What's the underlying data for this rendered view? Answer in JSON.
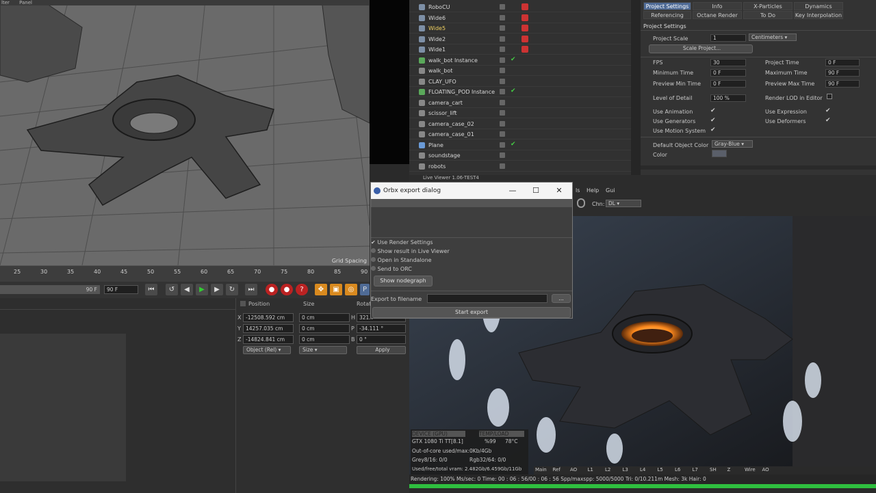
{
  "viewport": {
    "menu": [
      "lter",
      "Panel"
    ],
    "grid_label": "Grid Spacing"
  },
  "timeline": {
    "ticks": [
      "25",
      "30",
      "35",
      "40",
      "45",
      "50",
      "55",
      "60",
      "65",
      "70",
      "75",
      "80",
      "85",
      "90"
    ],
    "frame_field": "90 F",
    "slider_value": "90 F"
  },
  "coordinates": {
    "headers": {
      "position": "Position",
      "size": "Size",
      "rotation": "Rotat"
    },
    "rows": [
      {
        "axis": "X",
        "pos": "-12508.592 cm",
        "size": "0 cm",
        "rot_axis": "H",
        "rot": "321.7"
      },
      {
        "axis": "Y",
        "pos": "14257.035 cm",
        "size": "0 cm",
        "rot_axis": "P",
        "rot": "-34.111 °"
      },
      {
        "axis": "Z",
        "pos": "-14824.841 cm",
        "size": "0 cm",
        "rot_axis": "B",
        "rot": "0 °"
      }
    ],
    "mode": "Object (Rel)",
    "size_mode": "Size",
    "apply": "Apply"
  },
  "objects": [
    {
      "name": "RoboCU",
      "icon": "camera-icon",
      "tag": true
    },
    {
      "name": "Wide6",
      "icon": "camera-icon",
      "tag": true
    },
    {
      "name": "Wide5",
      "icon": "camera-icon",
      "tag": true,
      "highlight": true
    },
    {
      "name": "Wide2",
      "icon": "camera-icon",
      "tag": true
    },
    {
      "name": "Wide1",
      "icon": "camera-icon",
      "tag": true
    },
    {
      "name": "walk_bot Instance",
      "icon": "instance-icon",
      "check": true
    },
    {
      "name": "walk_bot",
      "icon": "null-icon"
    },
    {
      "name": "CLAY_UFO",
      "icon": "null-icon"
    },
    {
      "name": "FLOATING_POD Instance",
      "icon": "instance-icon",
      "check": true
    },
    {
      "name": "camera_cart",
      "icon": "null-icon"
    },
    {
      "name": "scissor_lift",
      "icon": "null-icon"
    },
    {
      "name": "camera_case_02",
      "icon": "null-icon"
    },
    {
      "name": "camera_case_01",
      "icon": "null-icon"
    },
    {
      "name": "Plane",
      "icon": "plane-icon",
      "check": true
    },
    {
      "name": "soundstage",
      "icon": "null-icon"
    },
    {
      "name": "robots",
      "icon": "null-icon"
    }
  ],
  "attributes": {
    "tabs": [
      {
        "label": "Project Settings",
        "active": true
      },
      {
        "label": "Info"
      },
      {
        "label": "X-Particles"
      },
      {
        "label": "Dynamics"
      },
      {
        "label": "Referencing"
      },
      {
        "label": "Octane Render"
      },
      {
        "label": "To Do"
      },
      {
        "label": "Key Interpolation"
      }
    ],
    "section": "Project Settings",
    "project_scale_label": "Project Scale",
    "project_scale": "1",
    "project_scale_unit": "Centimeters",
    "scale_button": "Scale Project...",
    "fps_label": "FPS",
    "fps": "30",
    "project_time_label": "Project Time",
    "project_time": "0 F",
    "min_time_label": "Minimum Time",
    "min_time": "0 F",
    "max_time_label": "Maximum Time",
    "max_time": "90 F",
    "preview_min_label": "Preview Min Time",
    "preview_min": "0 F",
    "preview_max_label": "Preview Max Time",
    "preview_max": "90 F",
    "lod_label": "Level of Detail",
    "lod": "100 %",
    "render_lod_label": "Render LOD in Editor",
    "use_animation": "Use Animation",
    "use_expression": "Use Expression",
    "use_generators": "Use Generators",
    "use_deformers": "Use Deformers",
    "use_motion": "Use Motion System",
    "default_color_label": "Default Object Color",
    "default_color": "Gray-Blue",
    "color_label": "Color"
  },
  "dialog": {
    "title": "Orbx export dialog",
    "options": [
      {
        "label": "Use Render Settings",
        "checked": true
      },
      {
        "label": "Show result in Live Viewer",
        "checked": false
      },
      {
        "label": "Open in Standalone",
        "checked": false
      },
      {
        "label": "Send to ORC",
        "checked": false
      }
    ],
    "nodegraph": "Show nodegraph",
    "filename_label": "Export to filename",
    "browse": "...",
    "start": "Start export"
  },
  "liveviewer": {
    "title": "Live Viewer 1.06-TEST4",
    "menu": [
      "ls",
      "Help",
      "Gui"
    ],
    "channel_label": "Chn:",
    "channel": "DL",
    "passes": [
      "Main",
      "Ref",
      "AO",
      "L1",
      "L2",
      "L3",
      "L4",
      "L5",
      "L6",
      "L7",
      "SH",
      "Z",
      "Wire",
      "AO"
    ]
  },
  "gpu": {
    "header_left": "DEVICE (GPU)",
    "header_right": "TEMP/LOAD",
    "device": "GTX 1080 Ti TT[8.1]",
    "load": "%99",
    "temp": "78°C",
    "ooc": "Out-of-core used/max:0Kb/4Gb",
    "grey": "Grey8/16: 0/0",
    "rgb": "Rgb32/64: 0/0",
    "vram": "Used/free/total vram: 2.482Gb/6.459Gb/11Gb"
  },
  "status": {
    "text": "Rendering: 100%   Ms/sec: 0    Time: 00 : 06 : 56/00 : 06 : 56   Spp/maxspp: 5000/5000    Tri: 0/10.211m     Mesh: 3k    Hair: 0",
    "progress": 1.0
  },
  "colors": {
    "accent": "#4f6b96",
    "record": "#bb2222",
    "progress": "#2fbf3f",
    "glow": "#ff8a1e"
  }
}
